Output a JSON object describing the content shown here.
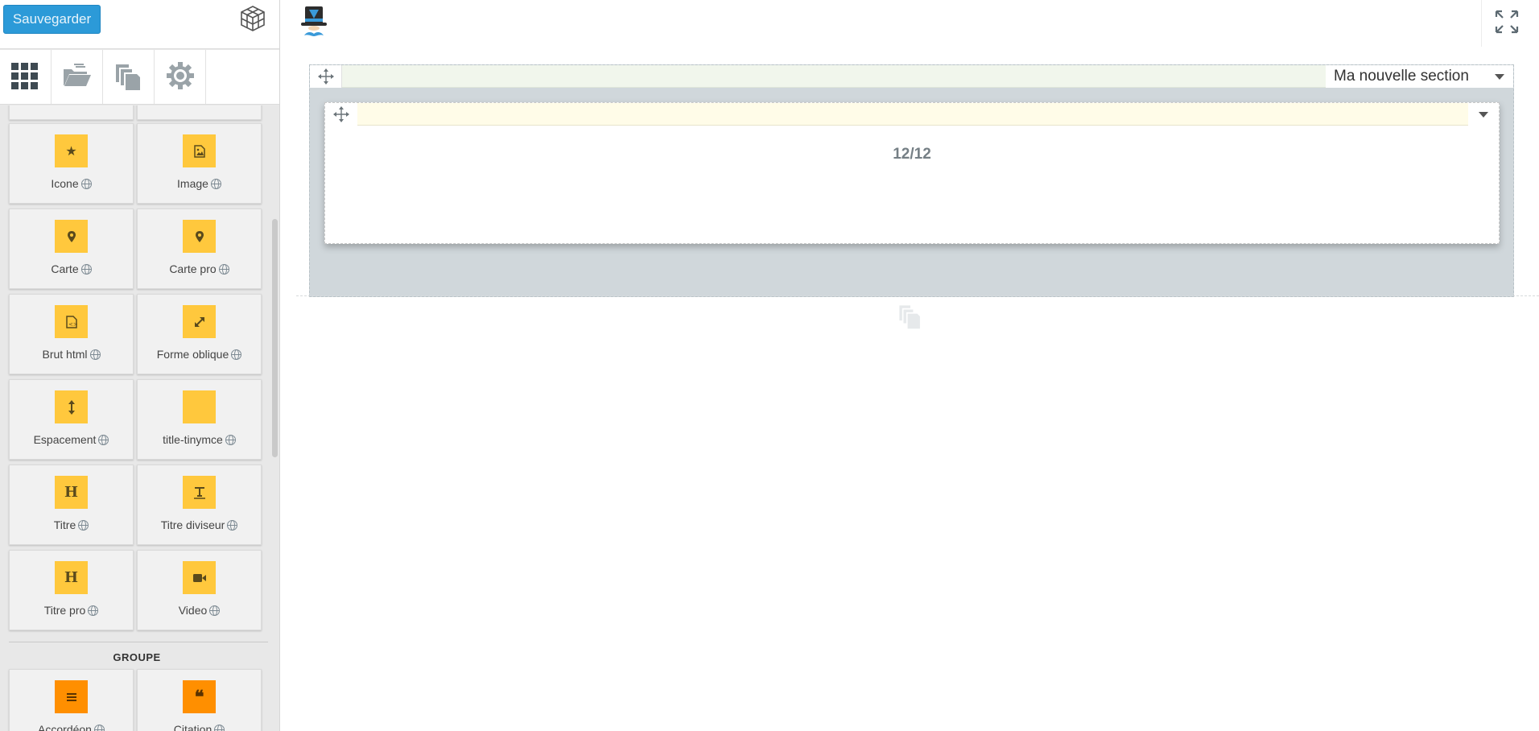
{
  "sidebar": {
    "save_label": "Sauvegarder",
    "tabs": [
      {
        "name": "grid",
        "icon": "grid-icon"
      },
      {
        "name": "folder",
        "icon": "folder-open-icon"
      },
      {
        "name": "pages",
        "icon": "copy-pages-icon"
      },
      {
        "name": "settings",
        "icon": "gear-icon"
      }
    ],
    "widgets": [
      {
        "label": "Icone",
        "icon": "star-icon"
      },
      {
        "label": "Image",
        "icon": "image-icon"
      },
      {
        "label": "Carte",
        "icon": "map-marker-icon"
      },
      {
        "label": "Carte pro",
        "icon": "map-marker-icon"
      },
      {
        "label": "Brut html",
        "icon": "html-file-icon"
      },
      {
        "label": "Forme oblique",
        "icon": "expand-diagonal-icon"
      },
      {
        "label": "Espacement",
        "icon": "vertical-spacing-icon"
      },
      {
        "label": "title-tinymce",
        "icon": "blank-icon"
      },
      {
        "label": "Titre",
        "icon": "heading-icon"
      },
      {
        "label": "Titre diviseur",
        "icon": "title-divider-icon"
      },
      {
        "label": "Titre pro",
        "icon": "heading-icon"
      },
      {
        "label": "Video",
        "icon": "video-camera-icon"
      }
    ],
    "group": {
      "title": "GROUPE",
      "widgets": [
        {
          "label": "Accordéon",
          "icon": "list-icon"
        },
        {
          "label": "Citation",
          "icon": "quote-icon"
        }
      ]
    }
  },
  "canvas": {
    "section_name": "Ma nouvelle section",
    "column_label": "12/12"
  },
  "colors": {
    "save_button": "#2c9ad8",
    "widget_badge": "#ffc83d",
    "group_badge": "#ff8f00",
    "section_bg": "#d0d7db",
    "section_header": "#f1f6ec",
    "row_header": "#fffce8"
  }
}
